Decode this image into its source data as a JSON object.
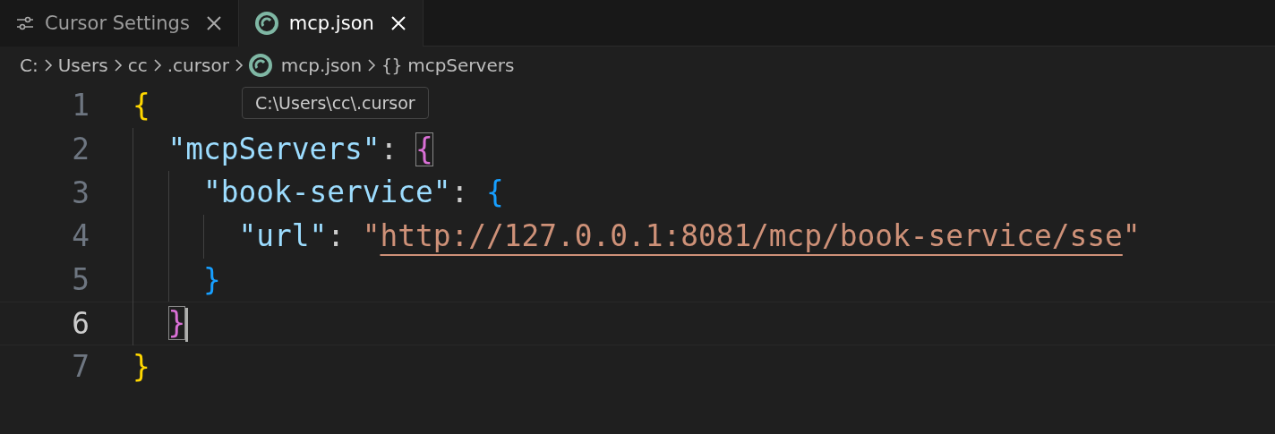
{
  "tabs": [
    {
      "label": "Cursor Settings",
      "kind": "settings",
      "selected": false
    },
    {
      "label": "mcp.json",
      "kind": "file",
      "selected": true
    }
  ],
  "breadcrumbs": [
    {
      "label": "C:",
      "kind": "folder"
    },
    {
      "label": "Users",
      "kind": "folder"
    },
    {
      "label": "cc",
      "kind": "folder"
    },
    {
      "label": ".cursor",
      "kind": "folder"
    },
    {
      "label": "mcp.json",
      "kind": "file"
    },
    {
      "label": "mcpServers",
      "kind": "symbol",
      "glyph": "{}"
    }
  ],
  "tooltip": {
    "text": "C:\\Users\\cc\\.cursor"
  },
  "editor": {
    "lines": [
      {
        "number": "1",
        "current": false,
        "tokens": [
          {
            "kind": "brace",
            "text": "{",
            "color": "#ffd700"
          }
        ]
      },
      {
        "number": "2",
        "current": false,
        "tokens": [
          {
            "kind": "key",
            "text": "  \"mcpServers\""
          },
          {
            "kind": "punct",
            "text": ": "
          },
          {
            "kind": "brace",
            "text": "{",
            "color": "#da70d6",
            "matched": true
          }
        ]
      },
      {
        "number": "3",
        "current": false,
        "tokens": [
          {
            "kind": "key",
            "text": "    \"book-service\""
          },
          {
            "kind": "punct",
            "text": ": "
          },
          {
            "kind": "brace",
            "text": "{",
            "color": "#179fff"
          }
        ]
      },
      {
        "number": "4",
        "current": false,
        "tokens": [
          {
            "kind": "key",
            "text": "      \"url\""
          },
          {
            "kind": "punct",
            "text": ": "
          },
          {
            "kind": "string",
            "text": "\""
          },
          {
            "kind": "link",
            "text": "http://127.0.0.1:8081/mcp/book-service/sse"
          },
          {
            "kind": "string",
            "text": "\""
          }
        ]
      },
      {
        "number": "5",
        "current": false,
        "tokens": [
          {
            "kind": "brace",
            "text": "    }",
            "color": "#179fff"
          }
        ]
      },
      {
        "number": "6",
        "current": true,
        "tokens": [
          {
            "kind": "brace",
            "text": "  }",
            "color": "#da70d6",
            "matched": true
          }
        ]
      },
      {
        "number": "7",
        "current": false,
        "tokens": [
          {
            "kind": "brace",
            "text": "}",
            "color": "#ffd700"
          }
        ]
      }
    ]
  }
}
